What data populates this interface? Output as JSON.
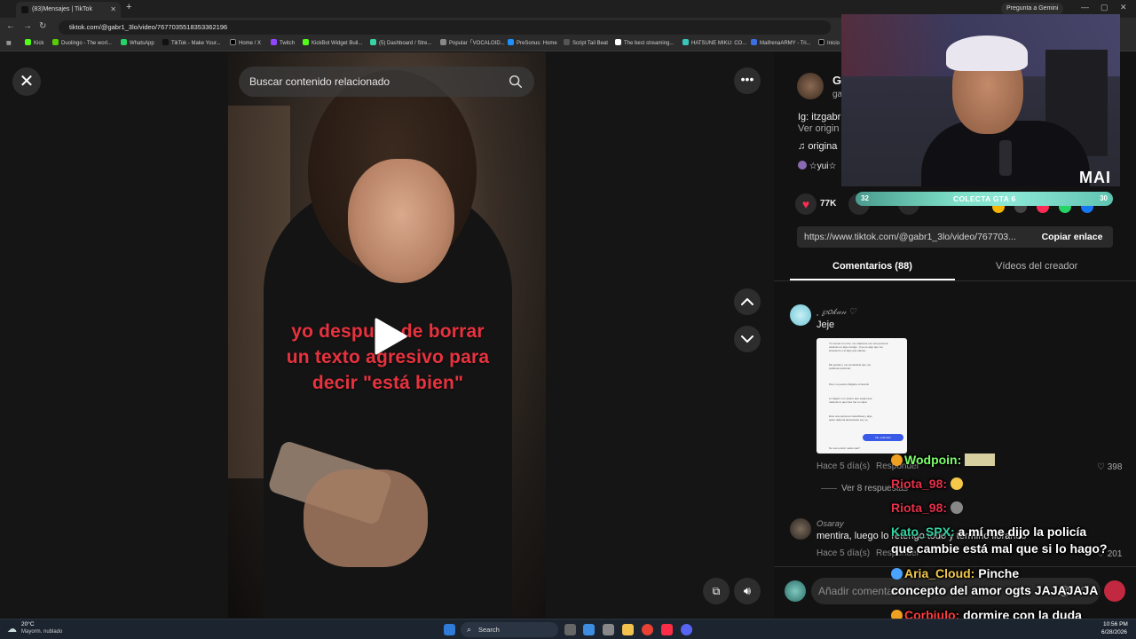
{
  "browser": {
    "tab_title": "(83)Mensajes | TikTok",
    "new_tab": "+",
    "gemini_button": "Pregunta a Gemini",
    "url": "tiktok.com/@gabr1_3lo/video/7677035518353362196",
    "bookmarks": [
      {
        "label": "Kick",
        "color": "#53fc18"
      },
      {
        "label": "Duolingo - The worl...",
        "color": "#58cc02"
      },
      {
        "label": "WhatsApp",
        "color": "#25d366"
      },
      {
        "label": "TikTok - Make Your...",
        "color": "#111111"
      },
      {
        "label": "Home / X",
        "color": "#000000"
      },
      {
        "label": "Twitch",
        "color": "#9146ff"
      },
      {
        "label": "KickBot Widget Buil...",
        "color": "#53fc18"
      },
      {
        "label": "(5) Dashboard / Stre...",
        "color": "#3ad1a7"
      },
      {
        "label": "Popular「VOCALOID...",
        "color": "#888888"
      },
      {
        "label": "PreSonus: Home",
        "color": "#1e90ff"
      },
      {
        "label": "Script Tail Beat",
        "color": "#333333"
      },
      {
        "label": "The best streaming...",
        "color": "#ffffff"
      },
      {
        "label": "HATSUNE MIKU: CO...",
        "color": "#39c5bb"
      },
      {
        "label": "MaifrenaARMY - Tri...",
        "color": "#3b6ee0"
      },
      {
        "label": "Inicio",
        "color": "#000000"
      }
    ]
  },
  "video": {
    "search_placeholder": "Buscar contenido relacionado",
    "caption": "yo después de borrar un texto agresivo para decir \"está bien\""
  },
  "creator": {
    "name_initial": "G",
    "handle_initial": "ga",
    "bio": "Ig: itzgabr",
    "see_original": "Ver origin",
    "sound": "origina",
    "tag": "☆yui☆"
  },
  "actions": {
    "likes": "77K"
  },
  "link": {
    "url": "https://www.tiktok.com/@gabr1_3lo/video/767703...",
    "copy_label": "Copiar enlace"
  },
  "tabs": {
    "comments": "Comentarios (88)",
    "creator_videos": "Vídeos del creador"
  },
  "comments": [
    {
      "user": "˳ ℘𝑜𝓀𝒶𝓃 ♡",
      "text": "Jeje",
      "time": "Hace 5 día(s)",
      "reply": "Responder",
      "likes": "398",
      "view_replies": "Ver 8 respuestas"
    },
    {
      "user": "Osaray",
      "text": "mentira, luego lo retengo todo y termino llorando",
      "time": "Hace 5 día(s)",
      "reply": "Responder",
      "likes": "201"
    }
  ],
  "screenshot_lines": [
    "Yo cometí un error, me relacione con una persona estando en algo contigo . Fue es algo que me arrepiento y él algo que planee.",
    "Me gustas y me encantaría que me pudieras perdonar.",
    "Pero no puedo obligarte a hacerlo",
    "Lo tiages o no quiero que sepas que nada de lo que hice fue tu culpa",
    "Eres una persona maravillosa y algo quien debería lamentarse soy yo.",
    "Ok, está bien",
    "No vas a decir nada más?"
  ],
  "comment_input": {
    "placeholder": "Añadir comentario..."
  },
  "overlay": {
    "cam_name": "MAI",
    "goal_label": "COLECTA GTA 6",
    "goal_current": "32",
    "goal_target": "30"
  },
  "chat": [
    {
      "user": "Wodpoin:",
      "message": "",
      "color": "#7dff6a"
    },
    {
      "user": "Riota_98:",
      "message": "",
      "color": "#e6304a"
    },
    {
      "user": "Riota_98:",
      "message": "",
      "color": "#e6304a"
    },
    {
      "user": "Kato_SPX:",
      "message": "a mí me dijo la policía",
      "color": "#34d1a0"
    },
    {
      "user": "",
      "message": "que cambie está mal que si lo hago?",
      "color": "#ffffff"
    },
    {
      "user": "Aria_Cloud:",
      "message": "Pinche",
      "color": "#f2c94c"
    },
    {
      "user": "",
      "message": "concepto del amor ogts JAJAJAJA",
      "color": "#ffffff"
    },
    {
      "user": "Corbiulo:",
      "message": "dormire con la duda",
      "color": "#ff3b3b"
    }
  ],
  "taskbar": {
    "weather_temp": "20°C",
    "weather_desc": "Mayorm. nublado",
    "search_label": "Search",
    "time": "10:56 PM",
    "date": "6/28/2026"
  }
}
